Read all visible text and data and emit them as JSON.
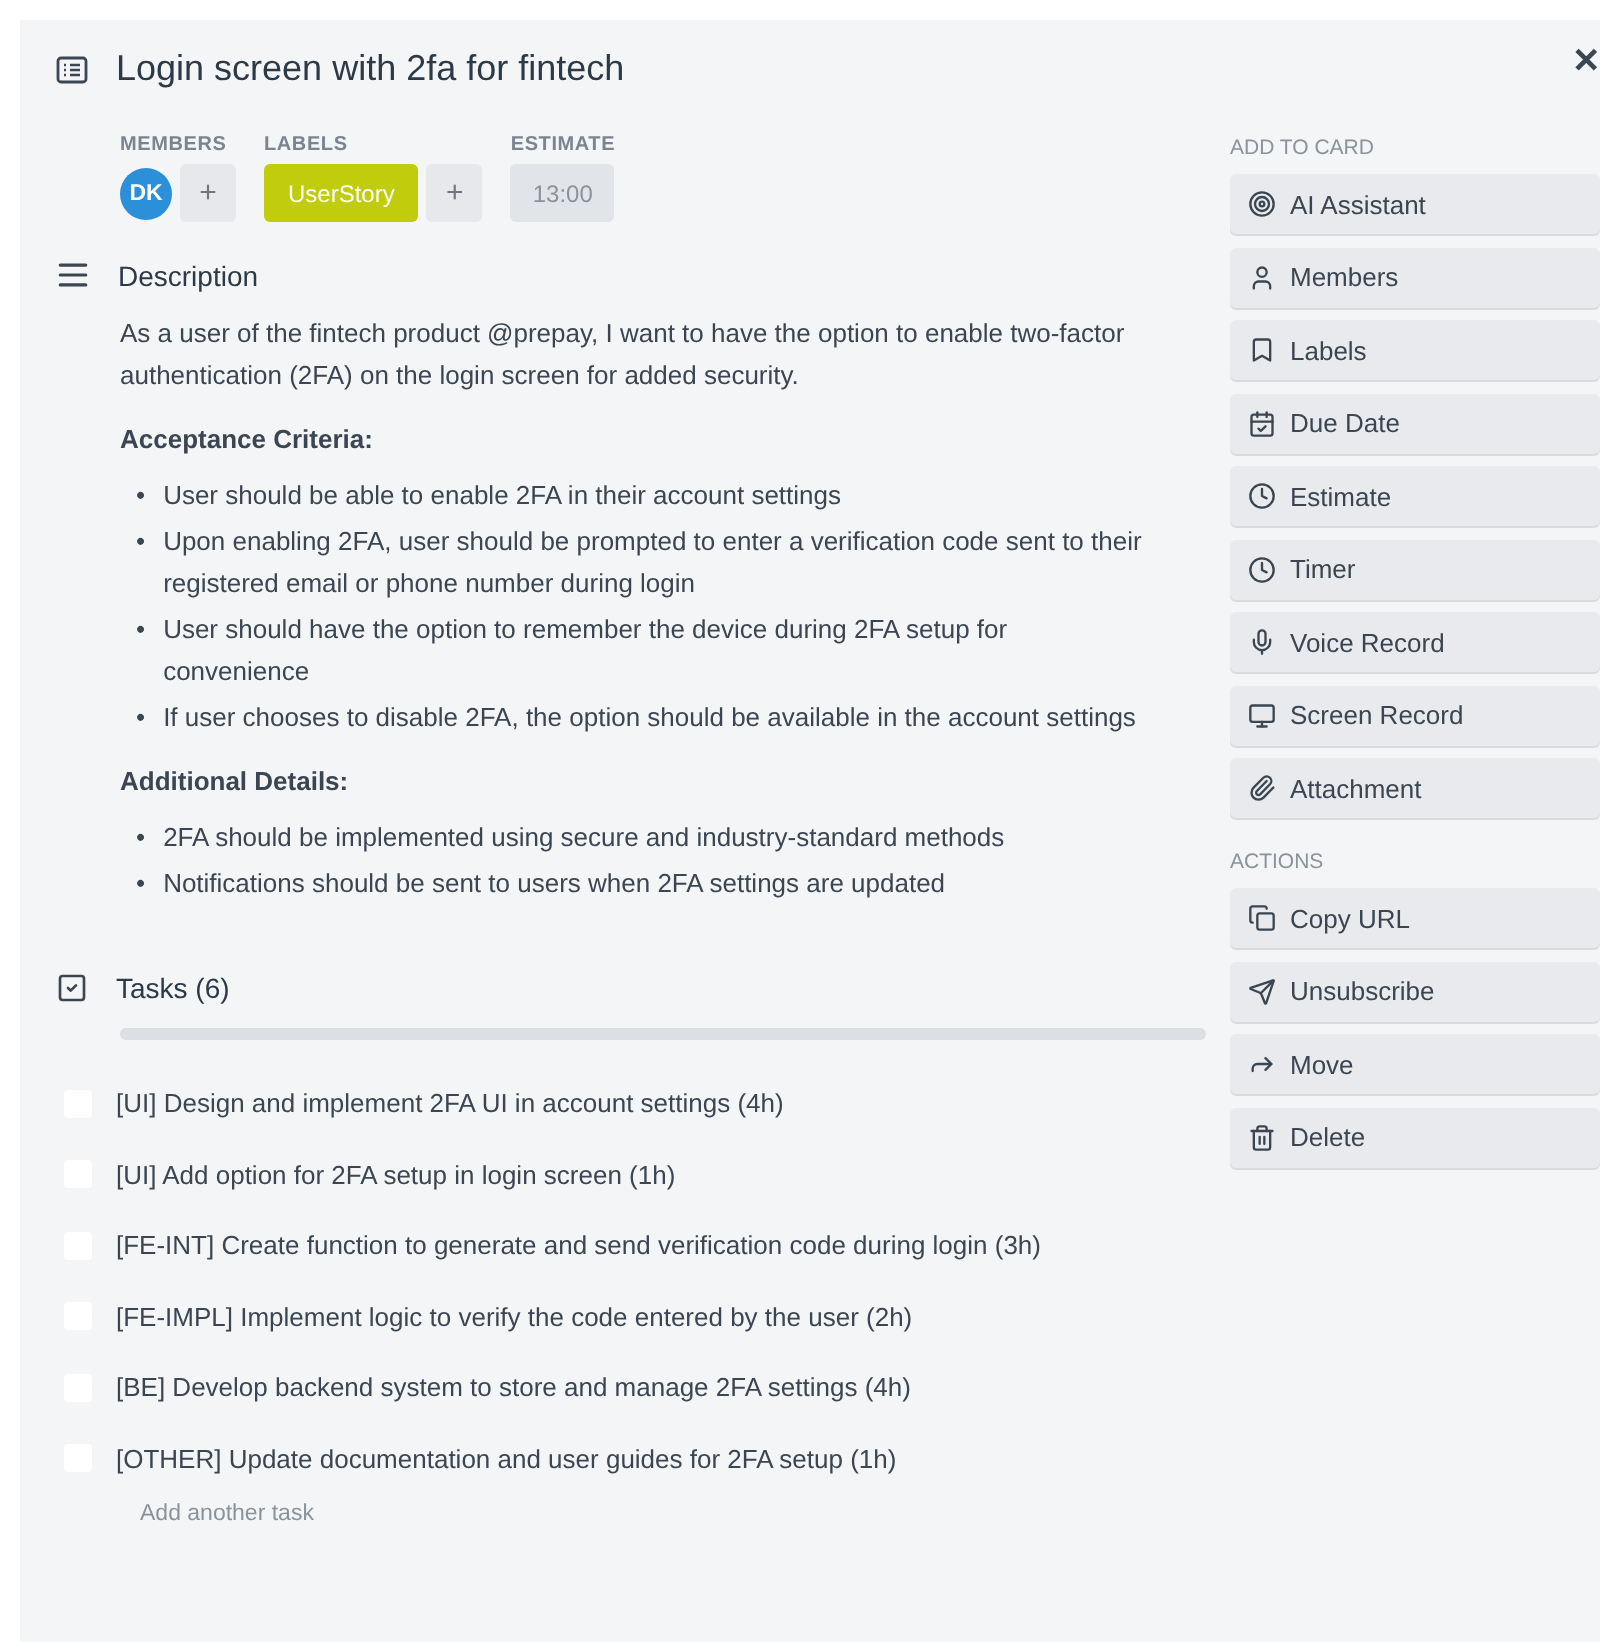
{
  "card": {
    "title": "Login screen with 2fa for fintech"
  },
  "meta": {
    "members_label": "MEMBERS",
    "member_initials": "DK",
    "add_member": "+",
    "labels_label": "LABELS",
    "label": {
      "text": "UserStory",
      "color": "#c0cc0c"
    },
    "add_label": "+",
    "estimate_label": "ESTIMATE",
    "estimate": "13:00"
  },
  "description": {
    "heading": "Description",
    "bullet": "•",
    "intro": "As a user of the fintech product @prepay, I want to have the option to enable two-factor authentication (2FA) on the login screen for added security.",
    "sections": [
      {
        "heading": "Acceptance Criteria:",
        "bullets": [
          "User should be able to enable 2FA in their account settings",
          "Upon enabling 2FA, user should be prompted to enter a verification code sent to their registered email or phone number during login",
          "User should have the option to remember the device during 2FA setup for convenience",
          "If user chooses to disable 2FA, the option should be available in the account settings"
        ]
      },
      {
        "heading": "Additional Details:",
        "bullets": [
          "2FA should be implemented using secure and industry-standard methods",
          "Notifications should be sent to users when 2FA settings are updated"
        ]
      }
    ]
  },
  "tasks": {
    "heading": "Tasks (6)",
    "items": [
      {
        "text": "[UI] Design and implement 2FA UI in account settings (4h)",
        "checked": false
      },
      {
        "text": "[UI] Add option for 2FA setup in login screen (1h)",
        "checked": false
      },
      {
        "text": "[FE-INT] Create function to generate and send verification code during login (3h)",
        "checked": false
      },
      {
        "text": "[FE-IMPL] Implement logic to verify the code entered by the user (2h)",
        "checked": false
      },
      {
        "text": "[BE] Develop backend system to store and manage 2FA settings (4h)",
        "checked": false
      },
      {
        "text": "[OTHER] Update documentation and user guides for 2FA setup (1h)",
        "checked": false
      }
    ],
    "add_placeholder": "Add another task"
  },
  "sidebar": {
    "groups": [
      {
        "heading": "ADD TO CARD",
        "buttons": [
          "AI Assistant",
          "Members",
          "Labels",
          "Due Date",
          "Estimate",
          "Timer",
          "Voice Record",
          "Screen Record",
          "Attachment"
        ]
      },
      {
        "heading": "ACTIONS",
        "buttons": [
          "Copy URL",
          "Unsubscribe",
          "Move",
          "Delete"
        ]
      }
    ]
  },
  "close": "✕"
}
